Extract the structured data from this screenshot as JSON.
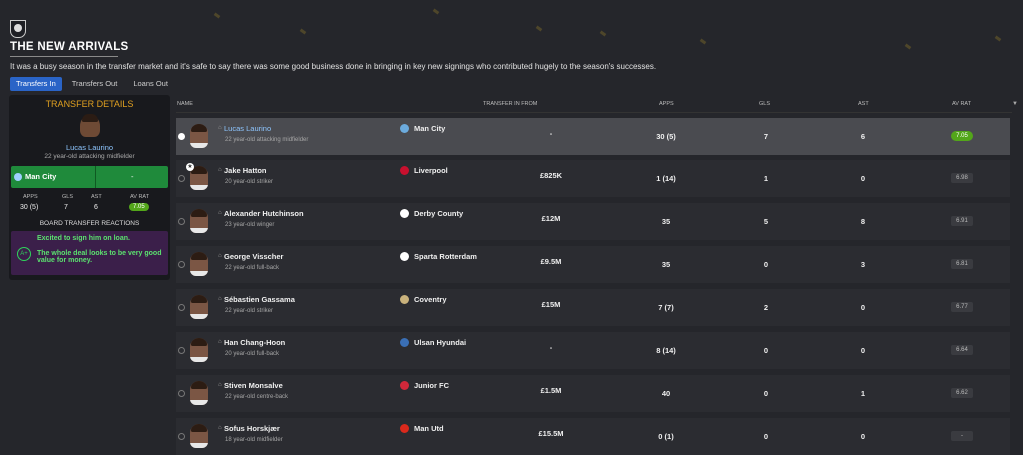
{
  "header": {
    "title": "THE NEW ARRIVALS",
    "intro": "It was a busy season in the transfer market and it's safe to say there was some good business done in bringing in key new signings who contributed hugely to the season's successes."
  },
  "tabs": [
    {
      "label": "Transfers In",
      "active": true
    },
    {
      "label": "Transfers Out",
      "active": false
    },
    {
      "label": "Loans Out",
      "active": false
    }
  ],
  "details": {
    "heading": "TRANSFER DETAILS",
    "name": "Lucas Laurino",
    "desc": "22 year-old attacking midfielder",
    "club": "Man City",
    "fee": "-",
    "stat_labels": [
      "APPS",
      "GLS",
      "AST",
      "AV RAT"
    ],
    "stat_values": [
      "30 (5)",
      "7",
      "6",
      "7.05"
    ],
    "reactions_heading": "BOARD TRANSFER REACTIONS",
    "grade": "A+",
    "reaction_1": "Excited to sign him on loan.",
    "reaction_2": "The whole deal looks to be very good value for money."
  },
  "table": {
    "columns": {
      "name": "NAME",
      "from": "TRANSFER IN FROM",
      "apps": "APPS",
      "gls": "GLS",
      "ast": "AST",
      "rat": "AV RAT"
    },
    "rows": [
      {
        "name": "Lucas Laurino",
        "desc": "22 year-old attacking midfielder",
        "club": "Man City",
        "club_color": "#6cabdd",
        "fee": "-",
        "apps": "30 (5)",
        "gls": "7",
        "ast": "6",
        "rat": "7.05",
        "selected": true,
        "star": false
      },
      {
        "name": "Jake Hatton",
        "desc": "20 year-old striker",
        "club": "Liverpool",
        "club_color": "#c8102e",
        "fee": "£825K",
        "apps": "1 (14)",
        "gls": "1",
        "ast": "0",
        "rat": "6.98",
        "selected": false,
        "star": true
      },
      {
        "name": "Alexander Hutchinson",
        "desc": "23 year-old winger",
        "club": "Derby County",
        "club_color": "#ffffff",
        "fee": "£12M",
        "apps": "35",
        "gls": "5",
        "ast": "8",
        "rat": "6.91",
        "selected": false,
        "star": false
      },
      {
        "name": "George Visscher",
        "desc": "22 year-old full-back",
        "club": "Sparta Rotterdam",
        "club_color": "#ffffff",
        "fee": "£9.5M",
        "apps": "35",
        "gls": "0",
        "ast": "3",
        "rat": "6.81",
        "selected": false,
        "star": false
      },
      {
        "name": "Sébastien Gassama",
        "desc": "22 year-old striker",
        "club": "Coventry",
        "club_color": "#c9b27c",
        "fee": "£15M",
        "apps": "7 (7)",
        "gls": "2",
        "ast": "0",
        "rat": "6.77",
        "selected": false,
        "star": false
      },
      {
        "name": "Han Chang-Hoon",
        "desc": "20 year-old full-back",
        "club": "Ulsan Hyundai",
        "club_color": "#3a6fb5",
        "fee": "-",
        "apps": "8 (14)",
        "gls": "0",
        "ast": "0",
        "rat": "6.64",
        "selected": false,
        "star": false
      },
      {
        "name": "Stiven Monsalve",
        "desc": "22 year-old centre-back",
        "club": "Junior FC",
        "club_color": "#d0283a",
        "fee": "£1.5M",
        "apps": "40",
        "gls": "0",
        "ast": "1",
        "rat": "6.62",
        "selected": false,
        "star": false
      },
      {
        "name": "Sofus Horskjær",
        "desc": "18 year-old midfielder",
        "club": "Man Utd",
        "club_color": "#da291c",
        "fee": "£15.5M",
        "apps": "0 (1)",
        "gls": "0",
        "ast": "0",
        "rat": "-",
        "selected": false,
        "star": false
      }
    ]
  },
  "colors": {
    "accent": "#2a64c7",
    "club_bar": "#1f8a3b",
    "rating_good": "#53a61a",
    "heading": "#e0a020"
  }
}
